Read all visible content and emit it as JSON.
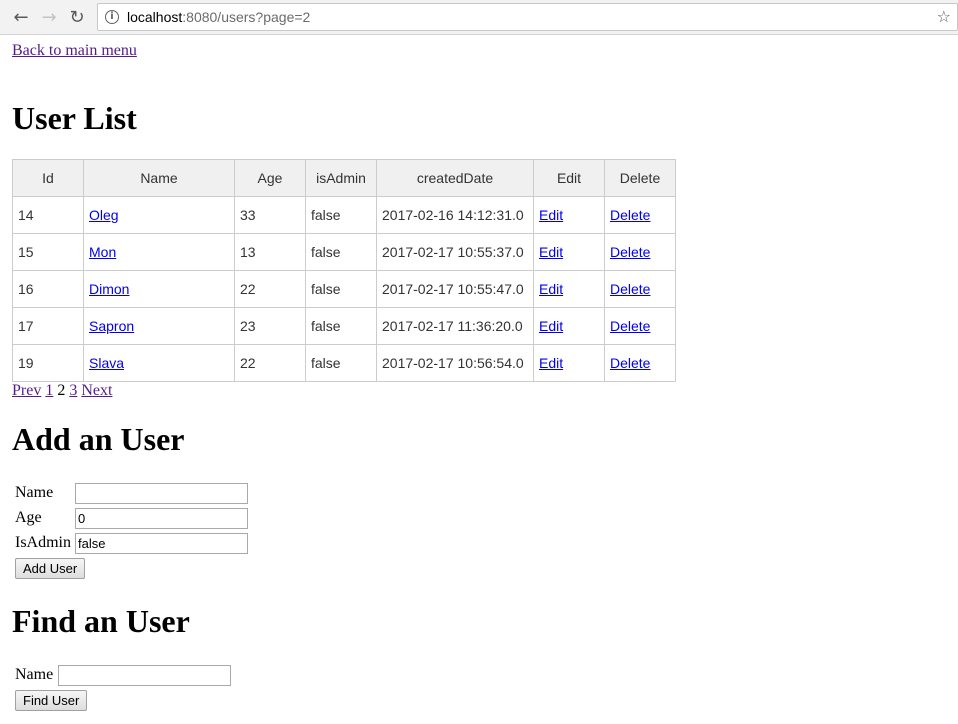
{
  "browser": {
    "url_host": "localhost",
    "url_rest": ":8080/users?page=2",
    "back_glyph": "←",
    "forward_glyph": "→",
    "reload_glyph": "↻",
    "star_glyph": "☆",
    "info_glyph": "i"
  },
  "back_link": "Back to main menu",
  "user_list": {
    "heading": "User List",
    "columns": [
      "Id",
      "Name",
      "Age",
      "isAdmin",
      "createdDate",
      "Edit",
      "Delete"
    ],
    "rows": [
      {
        "id": "14",
        "name": "Oleg",
        "age": "33",
        "is_admin": "false",
        "created": "2017-02-16 14:12:31.0",
        "edit": "Edit",
        "delete": "Delete"
      },
      {
        "id": "15",
        "name": "Mon",
        "age": "13",
        "is_admin": "false",
        "created": "2017-02-17 10:55:37.0",
        "edit": "Edit",
        "delete": "Delete"
      },
      {
        "id": "16",
        "name": "Dimon",
        "age": "22",
        "is_admin": "false",
        "created": "2017-02-17 10:55:47.0",
        "edit": "Edit",
        "delete": "Delete"
      },
      {
        "id": "17",
        "name": "Sapron",
        "age": "23",
        "is_admin": "false",
        "created": "2017-02-17 11:36:20.0",
        "edit": "Edit",
        "delete": "Delete"
      },
      {
        "id": "19",
        "name": "Slava",
        "age": "22",
        "is_admin": "false",
        "created": "2017-02-17 10:56:54.0",
        "edit": "Edit",
        "delete": "Delete"
      }
    ]
  },
  "pager": {
    "prev": "Prev",
    "page1": "1",
    "current": "2",
    "page3": "3",
    "next": "Next"
  },
  "add_user": {
    "heading": "Add an User",
    "name_label": "Name",
    "name_value": "",
    "age_label": "Age",
    "age_value": "0",
    "is_admin_label": "IsAdmin",
    "is_admin_value": "false",
    "submit": "Add User"
  },
  "find_user": {
    "heading": "Find an User",
    "name_label": "Name",
    "name_value": "",
    "submit": "Find User"
  }
}
